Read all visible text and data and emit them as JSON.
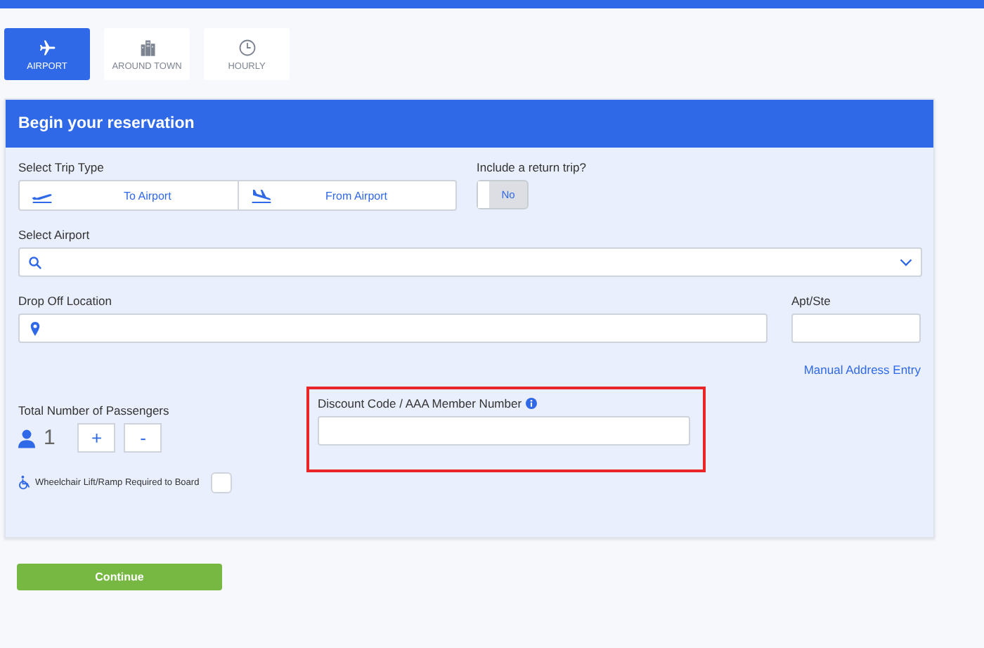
{
  "tabs": [
    {
      "label": "AIRPORT",
      "kind": "plane",
      "selected": true
    },
    {
      "label": "AROUND TOWN",
      "kind": "building",
      "selected": false
    },
    {
      "label": "HOURLY",
      "kind": "clock",
      "selected": false
    }
  ],
  "panel": {
    "title": "Begin your reservation"
  },
  "trip_type": {
    "label": "Select Trip Type",
    "options": [
      {
        "label": "To Airport",
        "kind": "takeoff"
      },
      {
        "label": "From Airport",
        "kind": "landing"
      }
    ]
  },
  "return_trip": {
    "label": "Include a return trip?",
    "value": "No",
    "on": false
  },
  "airport": {
    "label": "Select Airport"
  },
  "drop_off": {
    "label": "Drop Off Location"
  },
  "apt": {
    "label": "Apt/Ste"
  },
  "manual_link": "Manual Address Entry",
  "passengers": {
    "label": "Total Number of Passengers",
    "count": "1",
    "buttons": [
      "+",
      "-"
    ]
  },
  "discount": {
    "label": "Discount Code / AAA Member Number",
    "highlighted": true
  },
  "wheelchair": {
    "label": "Wheelchair Lift/Ramp Required to Board",
    "checked": false
  },
  "continue_button": "Continue"
}
